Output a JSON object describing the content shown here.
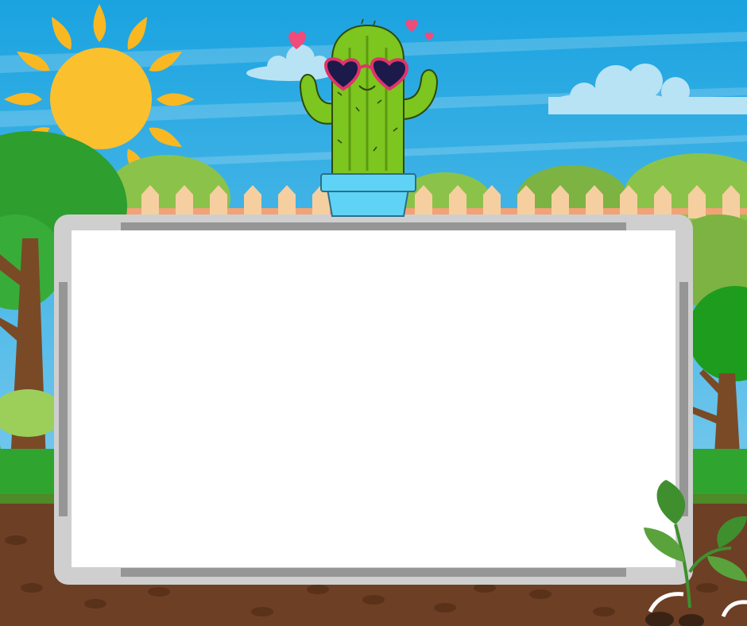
{
  "scene": {
    "colors": {
      "sky_top": "#1aa3e0",
      "sky_bottom": "#8fd3f1",
      "cloud": "#b8e3f5",
      "sun": "#fbc02d",
      "sun_rays": "#f9b822",
      "hill_light": "#8bc34a",
      "hill_dark": "#4caf50",
      "tree_green": "#2e9e2e",
      "tree_trunk": "#7a4a26",
      "fence": "#f6cfa0",
      "fence_rail": "#f2a277",
      "soil": "#6d3f24",
      "grass": "#2fa52f",
      "cactus": "#7dc51f",
      "cactus_dark": "#5a9a12",
      "pot": "#5fd3f5",
      "glasses_frame": "#e0336b",
      "glasses_lens": "#1b1a4a",
      "heart": "#ef4b7b",
      "board_frame": "#cfcfcf",
      "board_frame_dark": "#969696",
      "board_surface": "#ffffff",
      "sprout_leaf": "#3f8f2e"
    },
    "icons": [
      "sun-icon",
      "cactus-icon",
      "heart-icon",
      "sunglasses-icon",
      "sprout-icon",
      "tree-icon",
      "cloud-icon"
    ]
  },
  "whiteboard": {
    "content": ""
  }
}
